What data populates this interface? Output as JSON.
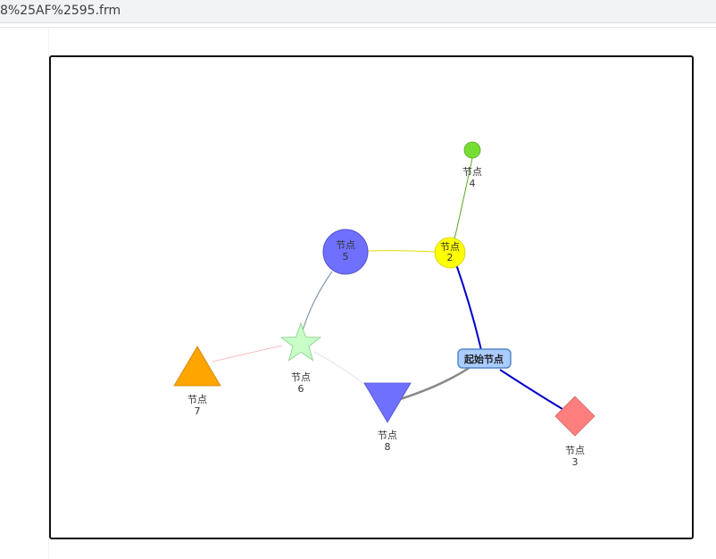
{
  "browser": {
    "url_fragment": "8%25AF%2595.frm"
  },
  "graph": {
    "start_node": {
      "label": "起始节点",
      "fill": "#aaccff",
      "stroke": "#5588cc"
    },
    "nodes": [
      {
        "id": "n2",
        "label_line1": "节点",
        "label_line2": "2",
        "shape": "circle",
        "color": "#ffff00"
      },
      {
        "id": "n3",
        "label_line1": "节点",
        "label_line2": "3",
        "shape": "diamond",
        "color": "#ff7f7f"
      },
      {
        "id": "n4",
        "label_line1": "节点",
        "label_line2": "4",
        "shape": "circle",
        "color": "#77dd33"
      },
      {
        "id": "n5",
        "label_line1": "节点",
        "label_line2": "5",
        "shape": "circle",
        "color": "#7070ff"
      },
      {
        "id": "n6",
        "label_line1": "节点",
        "label_line2": "6",
        "shape": "star",
        "color": "#c8ffc8"
      },
      {
        "id": "n7",
        "label_line1": "节点",
        "label_line2": "7",
        "shape": "triangle",
        "color": "#ffa500"
      },
      {
        "id": "n8",
        "label_line1": "节点",
        "label_line2": "8",
        "shape": "triangle-down",
        "color": "#7070ff"
      }
    ],
    "edges": [
      {
        "from": "start",
        "to": "n2",
        "color": "#0000cc"
      },
      {
        "from": "start",
        "to": "n3",
        "color": "#0000cc"
      },
      {
        "from": "start",
        "to": "n8",
        "color": "#888888"
      },
      {
        "from": "n2",
        "to": "n4",
        "color": "#55aa22"
      },
      {
        "from": "n2",
        "to": "n5",
        "color": "#dddd00"
      },
      {
        "from": "n5",
        "to": "n6",
        "color": "#8899aa"
      },
      {
        "from": "n6",
        "to": "n7",
        "color": "#ffaaaa"
      },
      {
        "from": "n6",
        "to": "n8",
        "color": "#dddddd"
      }
    ]
  }
}
